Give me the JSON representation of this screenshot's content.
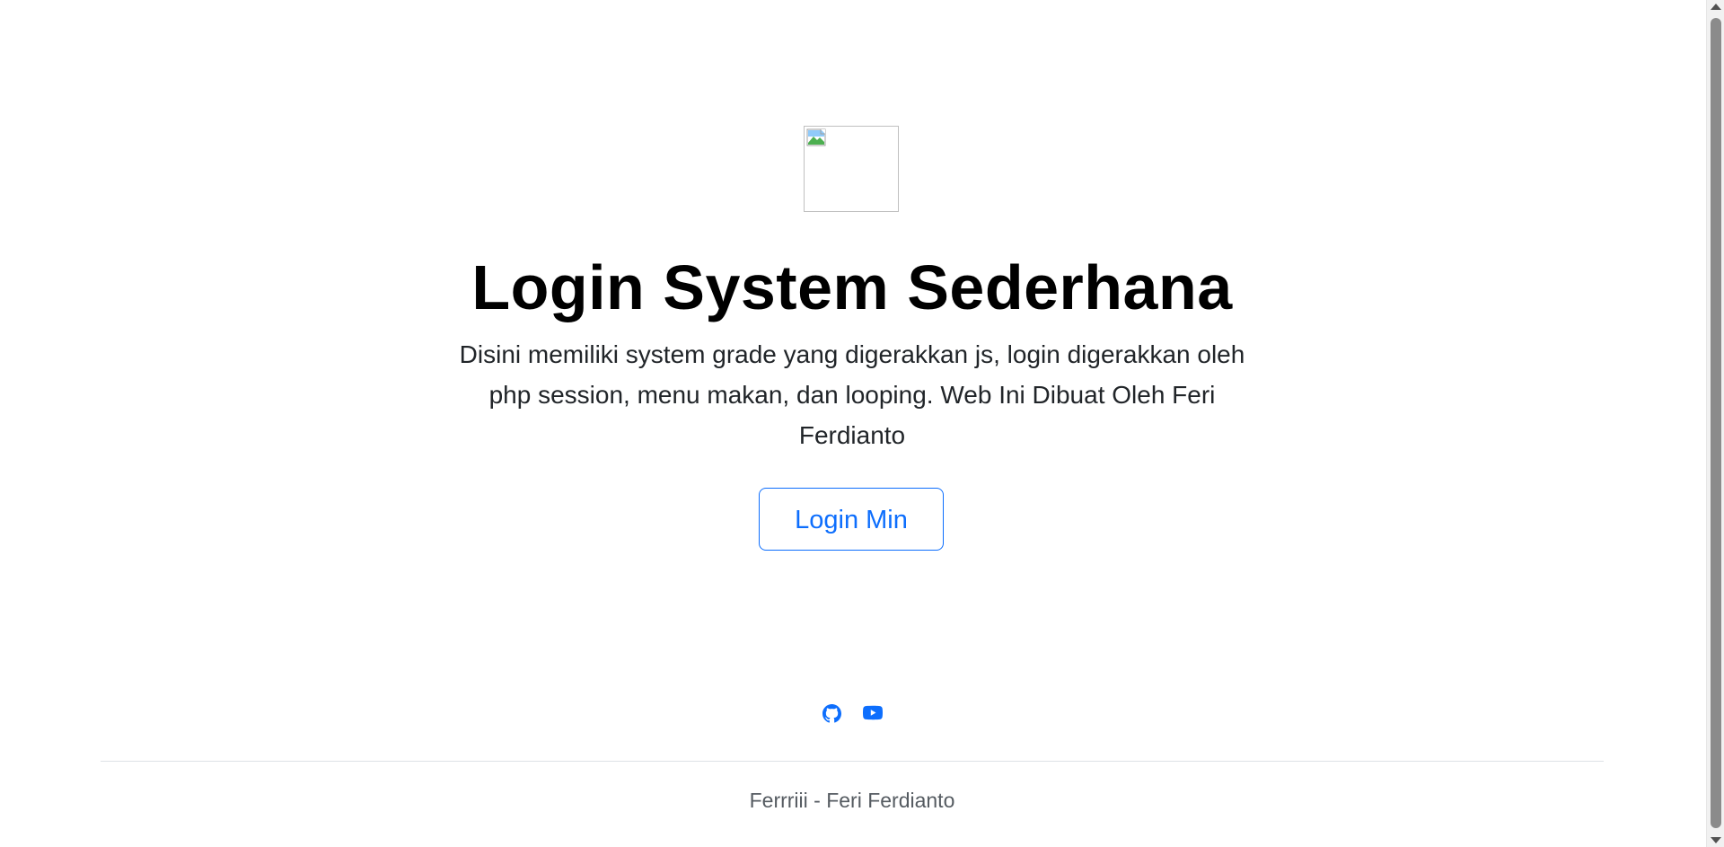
{
  "hero": {
    "logo_icon": "broken-image-icon",
    "title": "Login System Sederhana",
    "description": "Disini memiliki system grade yang digerakkan js, login digerakkan oleh php session, menu makan, dan looping. Web Ini Dibuat Oleh Feri Ferdianto",
    "login_button_label": "Login Min"
  },
  "social": {
    "github_icon": "github-icon",
    "youtube_icon": "youtube-icon"
  },
  "footer": {
    "text": "Ferrriii - Feri Ferdianto"
  },
  "colors": {
    "accent": "#0d6efd",
    "text": "#212529",
    "muted": "#555b61",
    "background": "#ffffff"
  }
}
